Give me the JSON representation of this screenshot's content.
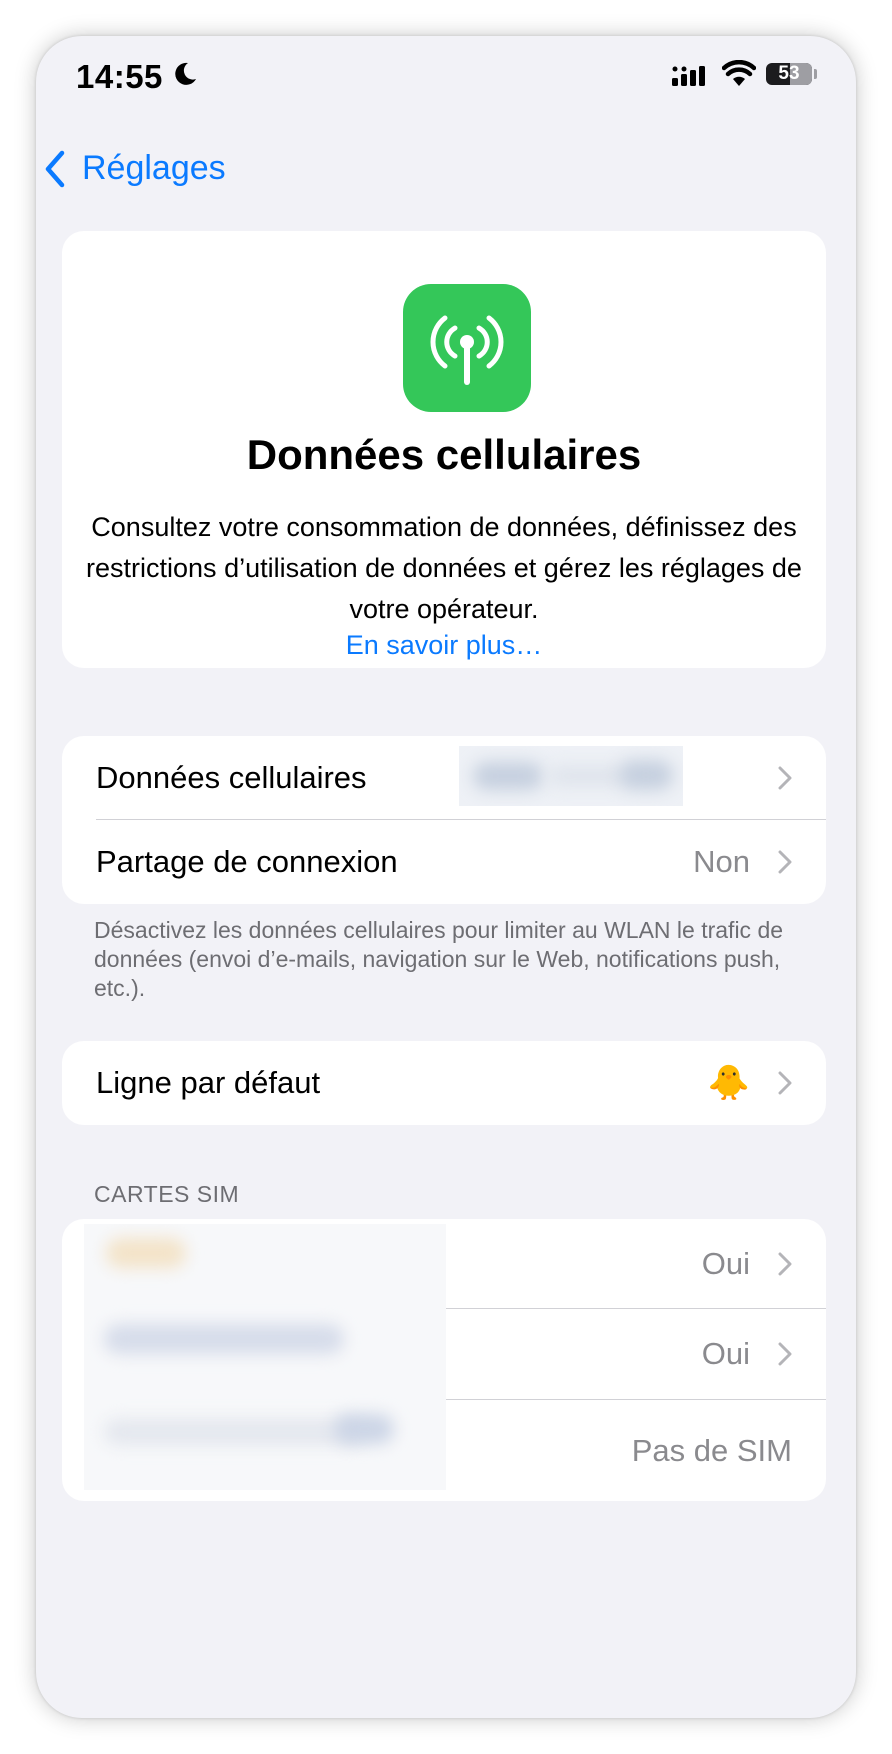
{
  "status_bar": {
    "time": "14:55",
    "battery": "53",
    "icons": [
      "moon-icon",
      "cellular-signal-icon",
      "wifi-icon",
      "battery-icon"
    ]
  },
  "nav": {
    "back_label": "Réglages"
  },
  "hero": {
    "icon": "antenna-icon",
    "icon_color": "#34c759",
    "title": "Données cellulaires",
    "description": "Consultez votre consommation de données, définissez des restrictions d’utilisation de données et gérez les réglages de votre opérateur.",
    "link": "En savoir plus…"
  },
  "group1": {
    "rows": [
      {
        "label": "Données cellulaires",
        "value": ""
      },
      {
        "label": "Partage de connexion",
        "value": "Non"
      }
    ],
    "footer": "Désactivez les données cellulaires pour limiter au WLAN le trafic de données (envoi d’e-mails, navigation sur le Web, notifications push, etc.)."
  },
  "group2": {
    "rows": [
      {
        "label": "Ligne par défaut",
        "value": "🐥"
      }
    ]
  },
  "sim_section": {
    "header": "CARTES SIM",
    "rows": [
      {
        "label": "",
        "value": "Oui"
      },
      {
        "label": "",
        "value": "Oui"
      },
      {
        "label": "",
        "value": "Pas de SIM"
      }
    ]
  },
  "colors": {
    "accent": "#0a7aff",
    "background": "#f2f2f7",
    "secondary_text": "#8a8a8e"
  }
}
